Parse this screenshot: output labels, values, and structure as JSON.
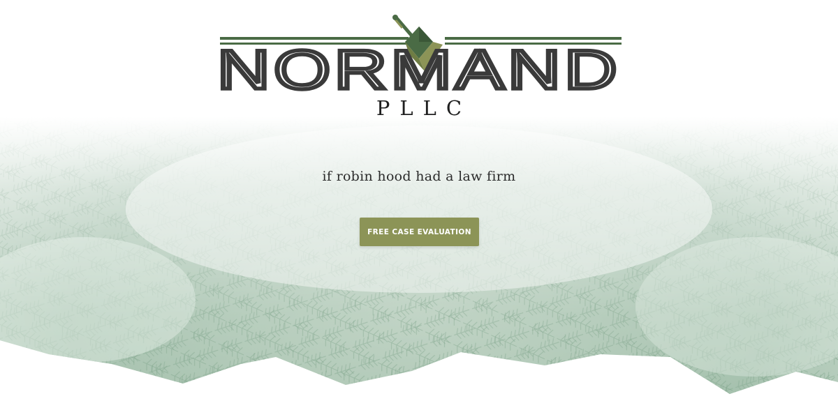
{
  "logo": {
    "wordmark": "NORMAND",
    "suffix": "PLLC",
    "icon": "diamond-trowel-icon"
  },
  "hero": {
    "tagline": "if robin hood had a law firm",
    "cta_label": "FREE CASE EVALUATION",
    "background": "misty-evergreen-foliage"
  },
  "colors": {
    "brand_green": "#4a6b45",
    "olive": "#8c9457",
    "logo_text": "#3a3a3a",
    "foliage": "#8fb29a"
  }
}
